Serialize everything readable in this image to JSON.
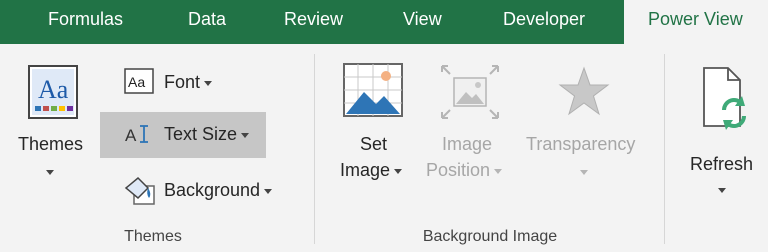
{
  "tabs": [
    {
      "label": "Formulas"
    },
    {
      "label": "Data"
    },
    {
      "label": "Review"
    },
    {
      "label": "View"
    },
    {
      "label": "Developer"
    },
    {
      "label": "Power View",
      "active": true
    }
  ],
  "groups": {
    "themes": {
      "label": "Themes",
      "themes_button": "Themes",
      "font_button": "Font",
      "text_size_button": "Text Size",
      "background_button": "Background"
    },
    "background_image": {
      "label": "Background Image",
      "set_image_line1": "Set",
      "set_image_line2": "Image",
      "image_position_line1": "Image",
      "image_position_line2": "Position",
      "transparency": "Transparency"
    },
    "refresh": {
      "label": "Refresh"
    }
  },
  "colors": {
    "tab_bar": "#217346",
    "active_tab_text": "#217346",
    "ribbon_bg": "#f3f3f3",
    "hover_highlight": "#c6c6c6",
    "disabled_text": "#a6a6a6"
  },
  "icons": [
    "themes-icon",
    "font-icon",
    "text-size-icon",
    "background-icon",
    "set-image-icon",
    "image-position-icon",
    "transparency-icon",
    "refresh-icon"
  ]
}
